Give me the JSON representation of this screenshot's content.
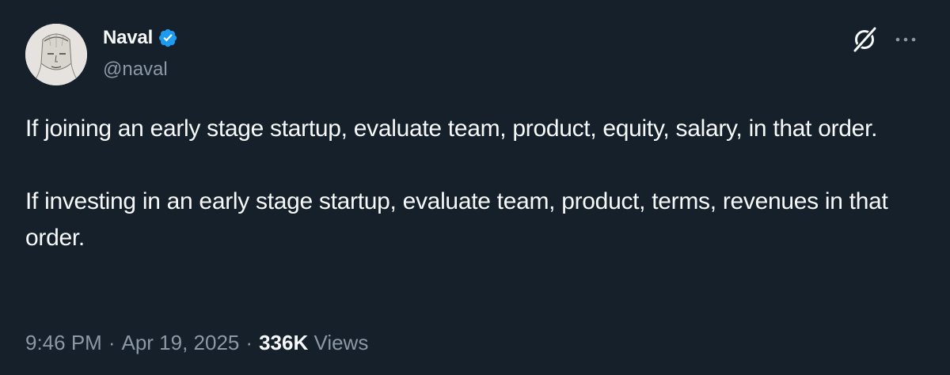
{
  "author": {
    "display_name": "Naval",
    "handle": "@naval",
    "verified": true,
    "verified_color": "#1d9bf0"
  },
  "header_icons": {
    "grok": "grok-icon",
    "more": "more-icon"
  },
  "tweet": {
    "paragraphs": [
      "If joining an early stage startup, evaluate team, product, equity, salary, in that order.",
      "If investing in an early stage startup, evaluate team, product, terms, revenues in that order."
    ]
  },
  "meta": {
    "time": "9:46 PM",
    "separator": "·",
    "date": "Apr 19, 2025",
    "views_count": "336K",
    "views_label": "Views"
  },
  "colors": {
    "background": "#15202b",
    "text": "#f7f9f9",
    "secondary_text": "#8b98a5",
    "accent": "#1d9bf0"
  }
}
